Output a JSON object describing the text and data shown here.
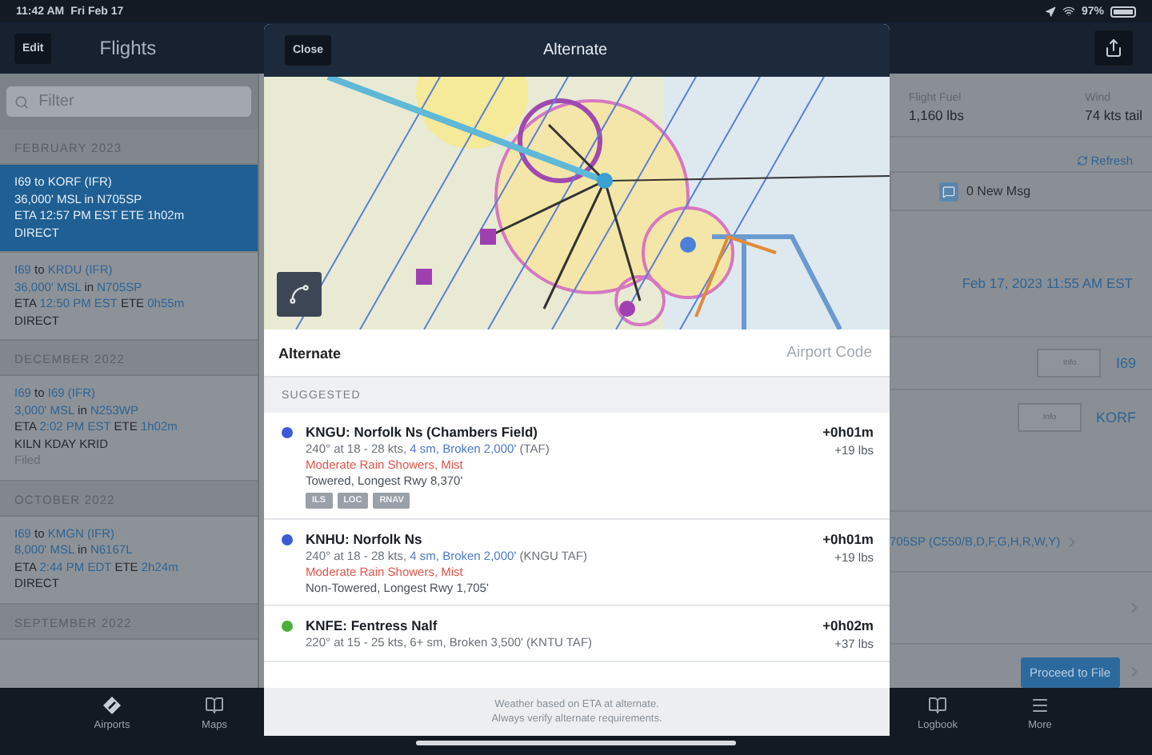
{
  "status_bar": {
    "time": "11:42 AM",
    "date": "Fri Feb 17",
    "battery": "97%"
  },
  "nav": {
    "edit": "Edit",
    "title": "Flights"
  },
  "filter": {
    "placeholder": "Filter"
  },
  "flight_groups": [
    {
      "header": "FEBRUARY 2023",
      "flights": [
        {
          "selected": true,
          "lines": [
            [
              {
                "t": "I69",
                "kind": "value"
              },
              {
                "t": "to",
                "kind": "label"
              },
              {
                "t": "KORF (IFR)",
                "kind": "value"
              }
            ],
            [
              {
                "t": "36,000' MSL",
                "kind": "value"
              },
              {
                "t": "in",
                "kind": "label"
              },
              {
                "t": "N705SP",
                "kind": "value"
              }
            ],
            [
              {
                "t": "ETA",
                "kind": "label"
              },
              {
                "t": "12:57 PM EST",
                "kind": "value"
              },
              {
                "t": "ETE",
                "kind": "label"
              },
              {
                "t": "1h02m",
                "kind": "value"
              }
            ],
            [
              {
                "t": "DIRECT",
                "kind": "label"
              }
            ]
          ]
        },
        {
          "selected": false,
          "lines": [
            [
              {
                "t": "I69",
                "kind": "value"
              },
              {
                "t": "to",
                "kind": "label"
              },
              {
                "t": "KRDU (IFR)",
                "kind": "value"
              }
            ],
            [
              {
                "t": "36,000' MSL",
                "kind": "value"
              },
              {
                "t": "in",
                "kind": "label"
              },
              {
                "t": "N705SP",
                "kind": "value"
              }
            ],
            [
              {
                "t": "ETA",
                "kind": "label"
              },
              {
                "t": "12:50 PM EST",
                "kind": "value"
              },
              {
                "t": "ETE",
                "kind": "label"
              },
              {
                "t": "0h55m",
                "kind": "value"
              }
            ],
            [
              {
                "t": "DIRECT",
                "kind": "label"
              }
            ]
          ]
        }
      ]
    },
    {
      "header": "DECEMBER 2022",
      "flights": [
        {
          "selected": false,
          "lines": [
            [
              {
                "t": "I69",
                "kind": "value"
              },
              {
                "t": "to",
                "kind": "label"
              },
              {
                "t": "I69 (IFR)",
                "kind": "value"
              }
            ],
            [
              {
                "t": "3,000' MSL",
                "kind": "value"
              },
              {
                "t": "in",
                "kind": "label"
              },
              {
                "t": "N253WP",
                "kind": "value"
              }
            ],
            [
              {
                "t": "ETA",
                "kind": "label"
              },
              {
                "t": "2:02 PM EST",
                "kind": "value"
              },
              {
                "t": "ETE",
                "kind": "label"
              },
              {
                "t": "1h02m",
                "kind": "value"
              }
            ],
            [
              {
                "t": "KILN KDAY KRID",
                "kind": "label"
              }
            ],
            [
              {
                "t": "Filed",
                "kind": "muted"
              }
            ]
          ]
        }
      ]
    },
    {
      "header": "OCTOBER 2022",
      "flights": [
        {
          "selected": false,
          "lines": [
            [
              {
                "t": "I69",
                "kind": "value"
              },
              {
                "t": "to",
                "kind": "label"
              },
              {
                "t": "KMGN (IFR)",
                "kind": "value"
              }
            ],
            [
              {
                "t": "8,000' MSL",
                "kind": "value"
              },
              {
                "t": "in",
                "kind": "label"
              },
              {
                "t": "N6167L",
                "kind": "value"
              }
            ],
            [
              {
                "t": "ETA",
                "kind": "label"
              },
              {
                "t": "2:44 PM EDT",
                "kind": "value"
              },
              {
                "t": "ETE",
                "kind": "label"
              },
              {
                "t": "2h24m",
                "kind": "value"
              }
            ],
            [
              {
                "t": "DIRECT",
                "kind": "label"
              }
            ]
          ]
        }
      ]
    },
    {
      "header": "SEPTEMBER 2022"
    }
  ],
  "detail": {
    "fuel_label": "Flight Fuel",
    "fuel": "1,160 lbs",
    "wind_label": "Wind",
    "wind": "74 kts tail",
    "refresh": "Refresh",
    "messages": "0 New Msg",
    "departure_time": "Feb 17, 2023 11:55 AM EST",
    "info_rows": [
      {
        "button": "Info",
        "value": "I69"
      },
      {
        "button": "Info",
        "value": "KORF"
      }
    ],
    "aircraft": "705SP (C550/B,D,F,G,H,R,W,Y)",
    "proceed": "Proceed to File"
  },
  "tab_bar": {
    "left": [
      "Airports",
      "Maps"
    ],
    "right": [
      "Logbook",
      "More"
    ]
  },
  "modal": {
    "close": "Close",
    "title": "Alternate",
    "field_label": "Alternate",
    "field_placeholder": "Airport Code",
    "section": "SUGGESTED",
    "alternates": [
      {
        "color": "#3b5bd6",
        "title": "KNGU: Norfolk Ns (Chambers Field)",
        "wind": [
          {
            "t": "240° at 18 - 28 kts,",
            "hl": false
          },
          {
            "t": "4 sm,",
            "hl": true
          },
          {
            "t": "Broken 2,000'",
            "hl": true
          },
          {
            "t": "(TAF)",
            "hl": false
          }
        ],
        "weather": "Moderate Rain Showers, Mist",
        "facility": "Towered, Longest Rwy 8,370'",
        "tags": [
          "ILS",
          "LOC",
          "RNAV"
        ],
        "time": "+0h01m",
        "fuel": "+19 lbs"
      },
      {
        "color": "#3b5bd6",
        "title": "KNHU: Norfolk Ns",
        "wind": [
          {
            "t": "240° at 18 - 28 kts,",
            "hl": false
          },
          {
            "t": "4 sm,",
            "hl": true
          },
          {
            "t": "Broken 2,000'",
            "hl": true
          },
          {
            "t": "(KNGU TAF)",
            "hl": false
          }
        ],
        "weather": "Moderate Rain Showers, Mist",
        "facility": "Non-Towered, Longest Rwy 1,705'",
        "time": "+0h01m",
        "fuel": "+19 lbs"
      },
      {
        "color": "#4caf3a",
        "title": "KNFE: Fentress Nalf",
        "wind": [
          {
            "t": "220° at 15 - 25 kts, 6+ sm, Broken 3,500' (KNTU TAF)",
            "hl": false
          }
        ],
        "time": "+0h02m",
        "fuel": "+37 lbs"
      }
    ],
    "footer": [
      "Weather based on ETA at alternate.",
      "Always verify alternate requirements."
    ]
  }
}
